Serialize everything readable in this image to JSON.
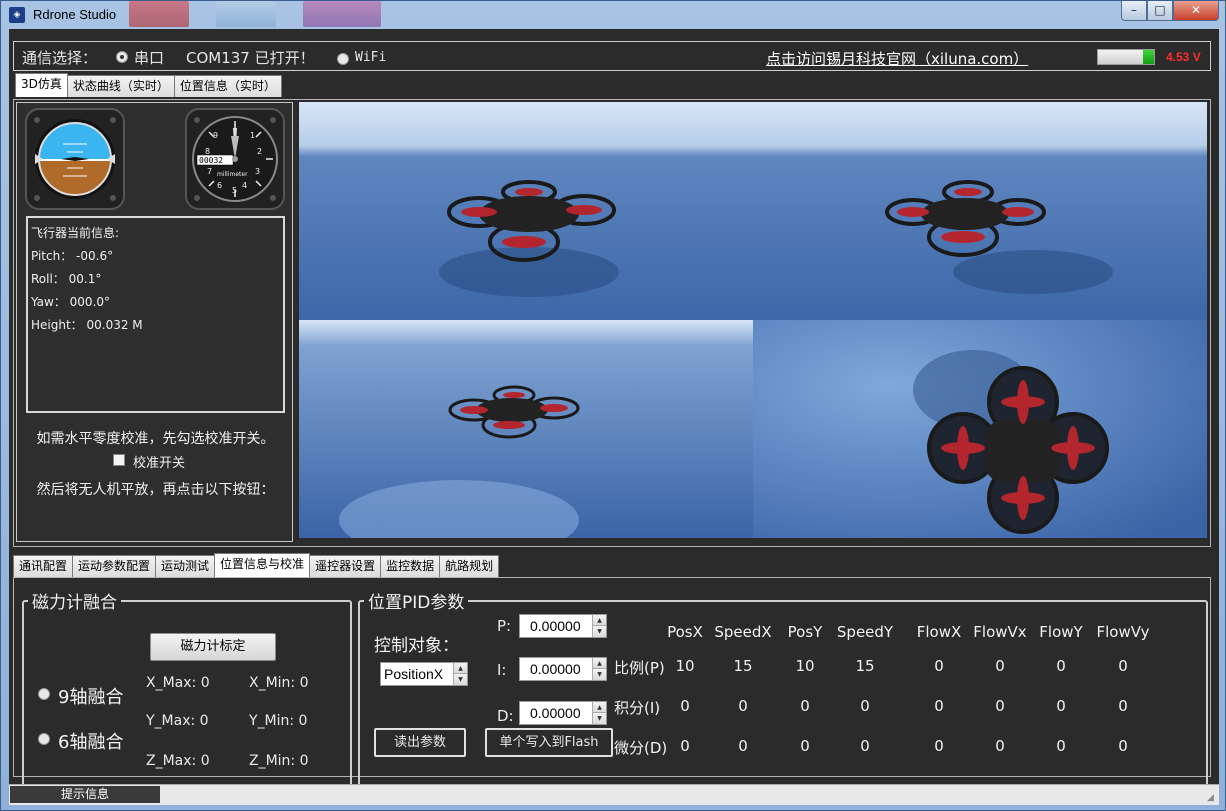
{
  "window": {
    "title": "Rdrone Studio",
    "app_icon": "drone-logo-icon",
    "min": "minimize-icon",
    "max": "maximize-icon",
    "close": "close-icon"
  },
  "comm": {
    "label": "通信选择：",
    "serial_label": "串口",
    "serial_checked": true,
    "com_status": "COM137 已打开！",
    "wifi_label": "WiFi",
    "wifi_checked": false,
    "website_link": "点击访问锡月科技官网（xiluna.com）",
    "battery_level": 0.2,
    "voltage": "4.53 V",
    "colors": {
      "voltage": "#ff2b2b",
      "battery": "#1fb81f"
    }
  },
  "main_tabs": [
    {
      "label": "3D仿真",
      "active": true
    },
    {
      "label": "状态曲线（实时）",
      "active": false
    },
    {
      "label": "位置信息（实时）",
      "active": false
    }
  ],
  "flight_info": {
    "heading": "飞行器当前信息:",
    "pitch": "Pitch： -00.6°",
    "roll": "Roll： 00.1°",
    "yaw": "Yaw： 000.0°",
    "height": "Height： 00.032 M"
  },
  "gauges": {
    "attitude_icon": "attitude-indicator-icon",
    "altimeter_icon": "altimeter-icon",
    "altimeter_unit": "millimeter",
    "altimeter_digits": "00032"
  },
  "calibration": {
    "tip1": "如需水平零度校准，先勾选校准开关。",
    "checkbox_label": "校准开关",
    "checked": false,
    "tip2": "然后将无人机平放，再点击以下按钮："
  },
  "views": [
    "drone-3d-view-front",
    "drone-3d-view-side",
    "drone-3d-view-low",
    "drone-3d-view-top"
  ],
  "bottom_tabs": [
    {
      "label": "通讯配置",
      "active": false
    },
    {
      "label": "运动参数配置",
      "active": false
    },
    {
      "label": "运动测试",
      "active": false
    },
    {
      "label": "位置信息与校准",
      "active": true
    },
    {
      "label": "遥控器设置",
      "active": false
    },
    {
      "label": "监控数据",
      "active": false
    },
    {
      "label": "航路规划",
      "active": false
    }
  ],
  "mag": {
    "title": "磁力计融合",
    "calib_button": "磁力计标定",
    "opt9": "9轴融合",
    "opt6": "6轴融合",
    "x_max": "X_Max: 0",
    "x_min": "X_Min: 0",
    "y_max": "Y_Max: 0",
    "y_min": "Y_Min: 0",
    "z_max": "Z_Max: 0",
    "z_min": "Z_Min: 0"
  },
  "pid": {
    "title": "位置PID参数",
    "target_label": "控制对象：",
    "target_value": "PositionX",
    "p_label": "P:",
    "i_label": "I:",
    "d_label": "D:",
    "p_value": "0.00000",
    "i_value": "0.00000",
    "d_value": "0.00000",
    "read_button": "读出参数",
    "write_button": "单个写入到Flash",
    "columns": [
      "PosX",
      "SpeedX",
      "PosY",
      "SpeedY",
      "FlowX",
      "FlowVx",
      "FlowY",
      "FlowVy"
    ],
    "rows": [
      {
        "label": "比例(P)",
        "values": [
          "10",
          "15",
          "10",
          "15",
          "0",
          "0",
          "0",
          "0"
        ]
      },
      {
        "label": "积分(I)",
        "values": [
          "0",
          "0",
          "0",
          "0",
          "0",
          "0",
          "0",
          "0"
        ]
      },
      {
        "label": "微分(D)",
        "values": [
          "0",
          "0",
          "0",
          "0",
          "0",
          "0",
          "0",
          "0"
        ]
      }
    ]
  },
  "status": {
    "label": "提示信息"
  }
}
